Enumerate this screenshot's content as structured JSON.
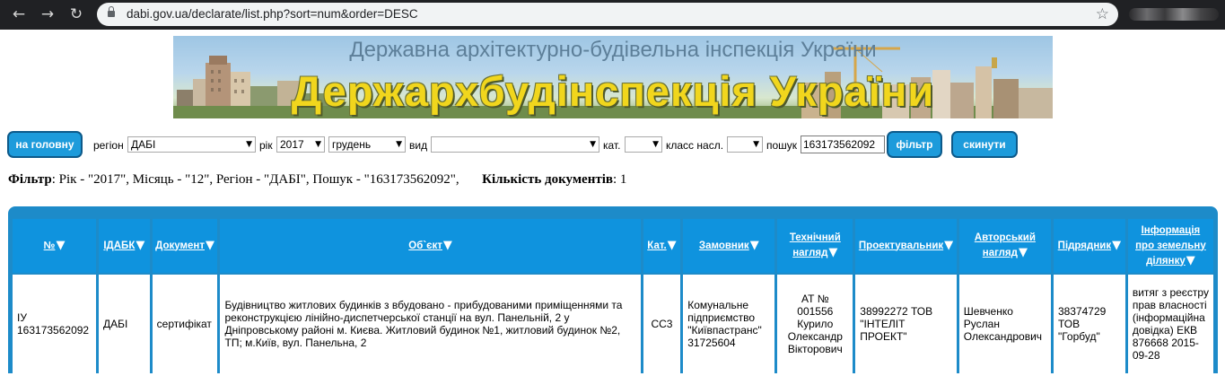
{
  "browser": {
    "url": "dabi.gov.ua/declarate/list.php?sort=num&order=DESC",
    "back_icon": "arrow-left-icon",
    "forward_icon": "arrow-right-icon",
    "reload_icon": "reload-icon",
    "star_icon": "bookmark-star-icon"
  },
  "banner": {
    "subtitle": "Державна архітектурно-будівельна інспекція України",
    "title": "Держархбудінспекція України"
  },
  "filters": {
    "home_button": "на головну",
    "region_label": "регіон",
    "region_value": "ДАБІ",
    "year_label": "рік",
    "year_value": "2017",
    "month_value": "грудень",
    "type_label": "вид",
    "type_value": "",
    "cat_label": "кат.",
    "cat_value": "",
    "class_label": "класс насл.",
    "class_value": "",
    "search_label": "пошук",
    "search_value": "163173562092",
    "filter_button": "фільтр",
    "reset_button": "скинути"
  },
  "summary": {
    "filter_label": "Фільтр",
    "filter_text": ": Рік - \"2017\", Місяць - \"12\", Регіон - \"ДАБІ\", Пошук - \"163173562092\",",
    "count_label": "Кількість документів",
    "count_value": ": 1"
  },
  "table": {
    "headers": [
      {
        "l1": "№",
        "l2": ""
      },
      {
        "l1": "ІДАБК",
        "l2": ""
      },
      {
        "l1": "Документ",
        "l2": ""
      },
      {
        "l1": "Об`єкт",
        "l2": ""
      },
      {
        "l1": "Кат.",
        "l2": ""
      },
      {
        "l1": "Замовник",
        "l2": ""
      },
      {
        "l1": "Технічний",
        "l2": "нагляд"
      },
      {
        "l1": "Проектувальник",
        "l2": ""
      },
      {
        "l1": "Авторський",
        "l2": "нагляд"
      },
      {
        "l1": "Підрядник",
        "l2": ""
      },
      {
        "l1": "Інформація про земельну",
        "l2": "ділянку"
      }
    ],
    "row": [
      "ІУ 163173562092",
      "ДАБІ",
      "сертифікат",
      "Будівництво житлових будинків з вбудовано - прибудованими приміщеннями та реконструкцією лінійно-диспетчерської станції на вул. Панельній, 2 у Дніпровському районі м. Києва. Житловий будинок №1, житловий будинок №2, ТП; м.Київ, вул. Панельна, 2",
      "СС3",
      "Комунальне підприємство \"Київпастранс\" 31725604",
      "АТ № 001556 Курило Олександр Вікторович",
      "38992272 ТОВ \"ІНТЕЛІТ ПРОЕКТ\"",
      "Шевченко Руслан Олександрович",
      "38374729 ТОВ \"Горбуд\"",
      "витяг з реєстру прав власності (інформаційна довідка) ЕКВ 876668 2015-09-28"
    ]
  }
}
